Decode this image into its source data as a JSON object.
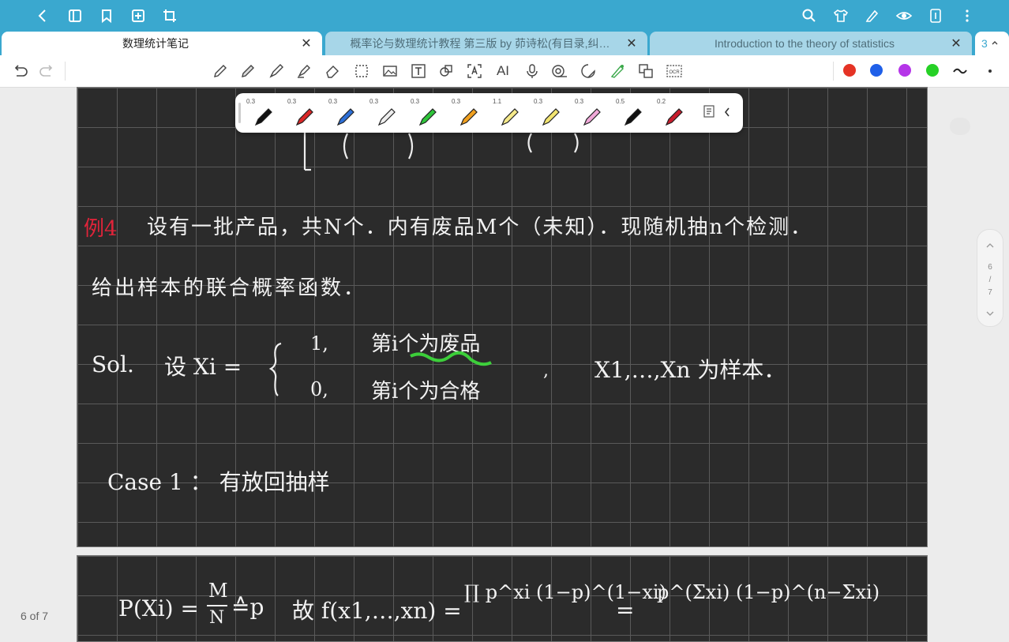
{
  "tabs": [
    {
      "label": "数理统计笔记"
    },
    {
      "label": "概率论与数理统计教程 第三版 by 茆诗松(有目录,纠…"
    },
    {
      "label": "Introduction to the theory of statistics"
    }
  ],
  "tab_count": "3",
  "pen_sizes": [
    "0.3",
    "0.3",
    "0.3",
    "0.3",
    "0.3",
    "0.3",
    "1.1",
    "0.3",
    "0.3",
    "0.5",
    "0.2"
  ],
  "pen_colors": [
    "#111111",
    "#d92626",
    "#2d6fd6",
    "#eeeeee",
    "#2ec43a",
    "#f0a020",
    "#f5e98a",
    "#f2e470",
    "#f0a8d8",
    "#111111",
    "#c81c2c"
  ],
  "palette": [
    "#e53325",
    "#1f5fe8",
    "#b535e8",
    "#26d126"
  ],
  "scroller": {
    "current": "6",
    "sep": "/",
    "total": "7"
  },
  "page_indicator": "6 of 7",
  "notes": {
    "example_label": "例4",
    "line1": "设有一批产品，共N个．内有废品M个（未知）．现随机抽n个检测．",
    "line2": "给出样本的联合概率函数．",
    "sol": "Sol.",
    "sol_def": "设 Xi =",
    "case_one_val": "1,",
    "case_one_text": "第i个为废品",
    "case_zero_val": "0,",
    "case_zero_text": "第i个为合格",
    "sample": "X1,…,Xn 为样本．",
    "case1": "Case 1 ： 有放回抽样",
    "formula_p": "P(Xi) =",
    "formula_mn_m": "M",
    "formula_mn_n": "N",
    "formula_eq_p": "≙p",
    "formula_f": "故 f(x1,…,xn) =",
    "formula_prod": "∏ p^xi (1−p)^(1−xi)",
    "formula_eq": "=",
    "formula_right": "p^(Σxi) (1−p)^(n−Σxi)"
  }
}
